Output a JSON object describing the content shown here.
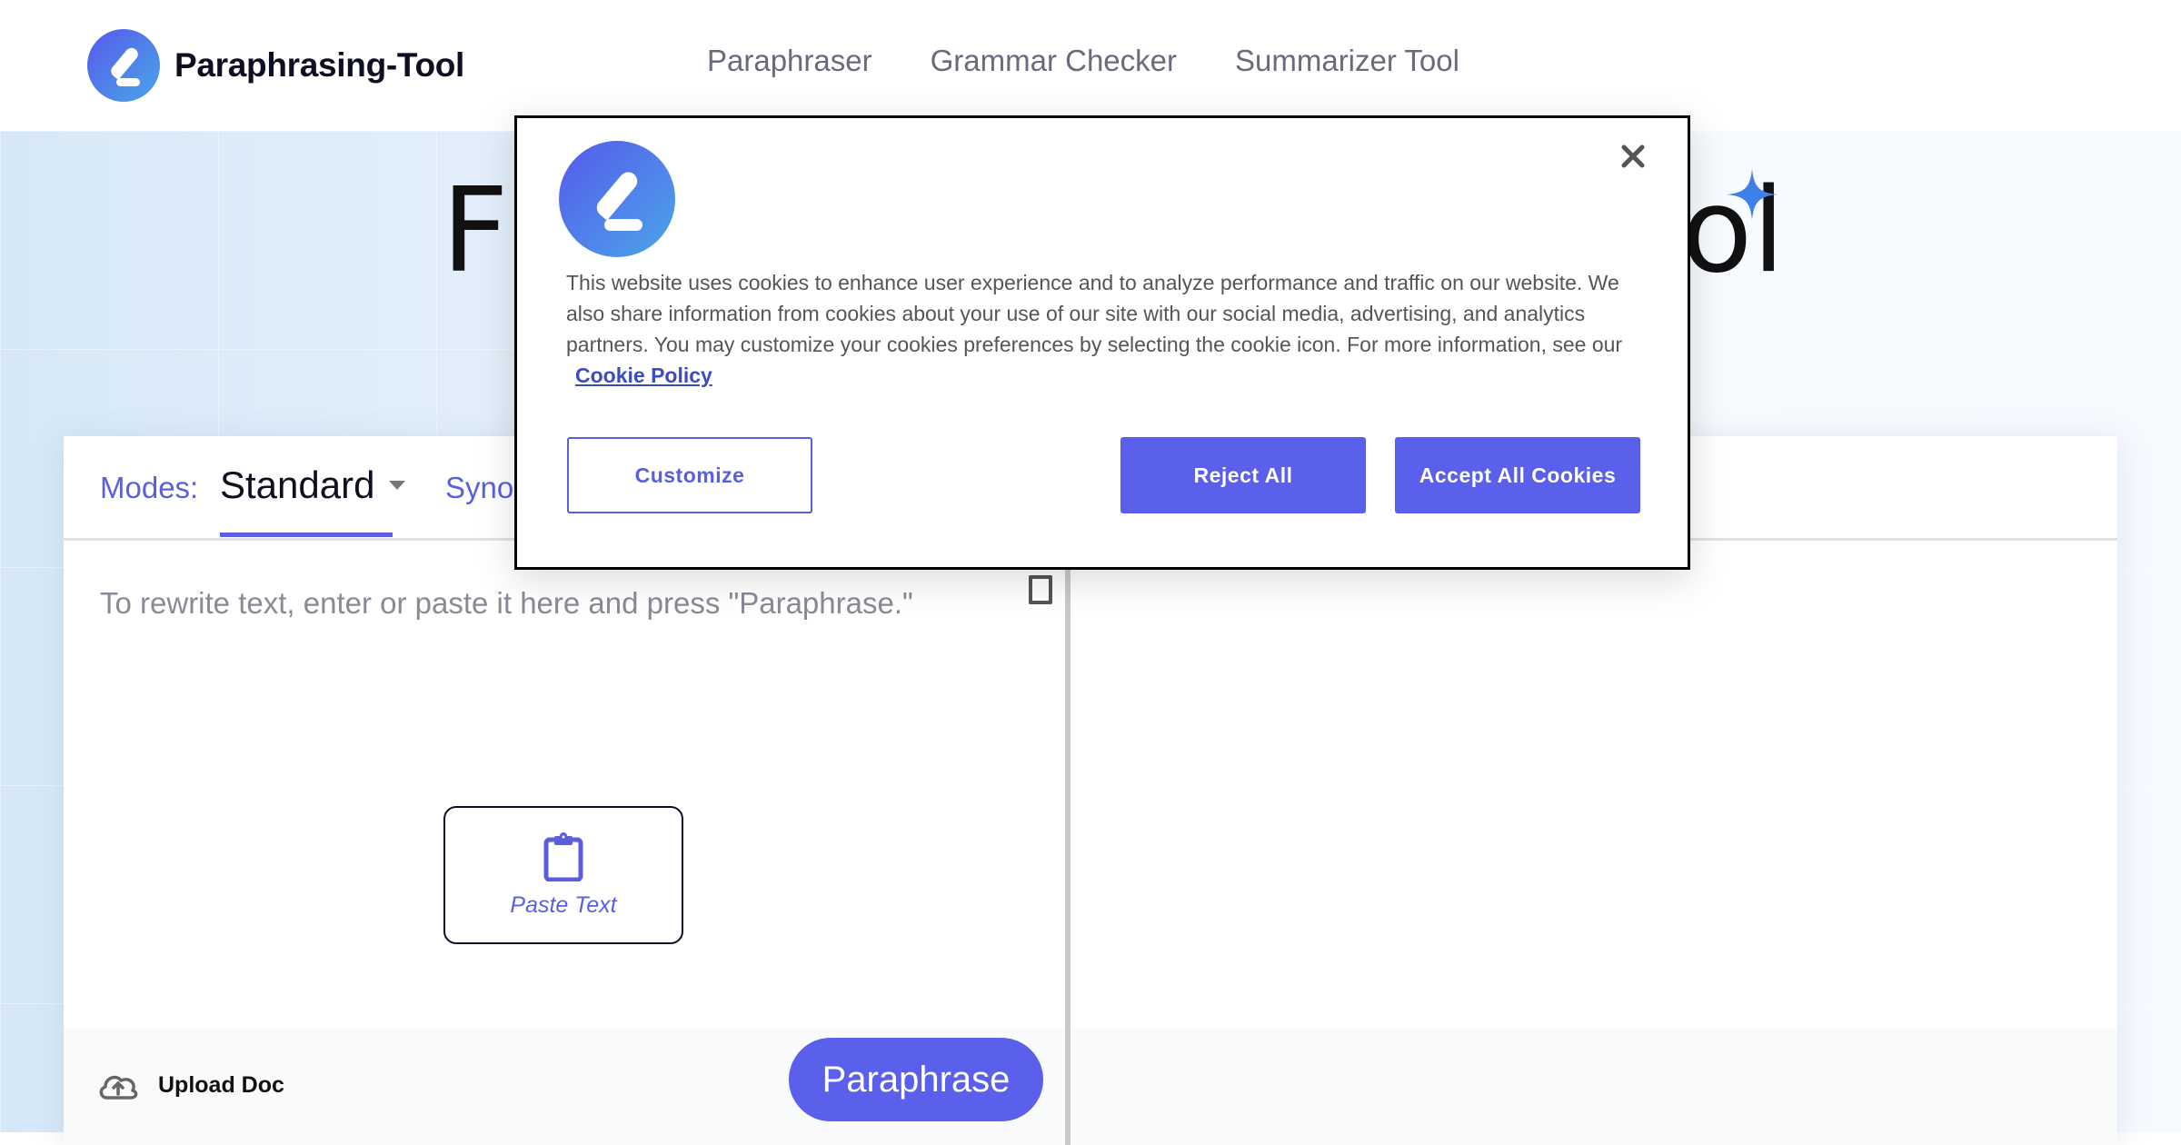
{
  "header": {
    "brand": "Paraphrasing-Tool",
    "nav": [
      "Paraphraser",
      "Grammar Checker",
      "Summarizer Tool"
    ]
  },
  "hero": {
    "title_start": "F",
    "title_end": "ol"
  },
  "editor": {
    "modes_label": "Modes:",
    "mode_value": "Standard",
    "synonyms_label_partial": "Syno",
    "placeholder": "To rewrite text, enter or paste it here and press \"Paraphrase.\"",
    "paste_label": "Paste Text",
    "upload_label": "Upload Doc",
    "paraphrase_label": "Paraphrase"
  },
  "cookie_modal": {
    "body": "This website uses cookies to enhance user experience and to analyze performance and traffic on our website. We also share information from cookies about your use of our site with our social media, advertising, and analytics partners. You may customize your cookies preferences by selecting the cookie icon. For more information, see our",
    "policy_link": "Cookie Policy",
    "customize": "Customize",
    "reject": "Reject All",
    "accept": "Accept All Cookies"
  },
  "colors": {
    "accent": "#5a5fec",
    "link": "#3b4cc0",
    "sparkle": "#3f7fe8"
  }
}
